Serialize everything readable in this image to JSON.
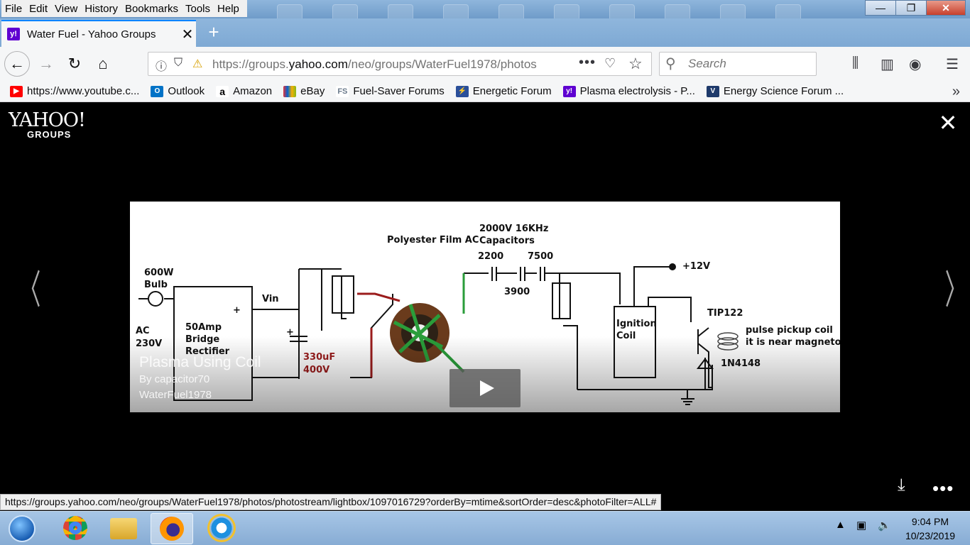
{
  "menu": {
    "items": [
      "File",
      "Edit",
      "View",
      "History",
      "Bookmarks",
      "Tools",
      "Help"
    ]
  },
  "window": {
    "minimize": "—",
    "maximize": "❐",
    "close": "✕"
  },
  "tab": {
    "title": "Water Fuel - Yahoo Groups",
    "favicon": "y!",
    "close": "✕",
    "new_tab": "+"
  },
  "nav": {
    "url_prefix": "https://groups.",
    "url_domain": "yahoo.com",
    "url_path": "/neo/groups/WaterFuel1978/photos",
    "search_placeholder": "Search"
  },
  "bookmarks": [
    {
      "label": "https://www.youtube.c...",
      "icon": "youtube-icon",
      "color": "#ff0000"
    },
    {
      "label": "Outlook",
      "icon": "outlook-icon",
      "color": "#0072c6"
    },
    {
      "label": "Amazon",
      "icon": "amazon-icon",
      "color": "#000000"
    },
    {
      "label": "eBay",
      "icon": "ebay-icon",
      "color": "#e53238"
    },
    {
      "label": "Fuel-Saver Forums",
      "icon": "fuelsaver-icon",
      "color": "#6b7b8c"
    },
    {
      "label": "Energetic Forum",
      "icon": "energetic-icon",
      "color": "#2a4f9a"
    },
    {
      "label": "Plasma electrolysis - P...",
      "icon": "yahoo-icon",
      "color": "#5f01d1"
    },
    {
      "label": "Energy Science Forum ...",
      "icon": "energyscience-icon",
      "color": "#1e3a6b"
    }
  ],
  "lightbox": {
    "logo_main": "YAHOO!",
    "logo_sub": "GROUPS",
    "close": "✕",
    "prev": "〈",
    "next": "〉",
    "photo": {
      "title": "Plasma Using Coil",
      "author": "By capacitor70",
      "group": "WaterFuel1978"
    }
  },
  "schematic": {
    "bulb": "600W\nBulb",
    "ac": "AC\n230V",
    "rectifier": "50Amp\nBridge\nRectifier",
    "plus": "+",
    "minus": "−",
    "vin": "Vin",
    "cap_plus": "+",
    "cap_value": "330uF",
    "cap_voltage": "400V",
    "film_caps": "Polyester Film AC",
    "rating": "2000V 16KHz",
    "capacitors": "Capacitors",
    "c1": "2200",
    "c2": "7500",
    "c3": "3900",
    "v12": "+12V",
    "ignition": "Ignition",
    "coil": "Coil",
    "tip": "TIP122",
    "pickup1": "pulse pickup coil",
    "pickup2": "it is near magneto",
    "diode": "1N4148"
  },
  "status_url": "https://groups.yahoo.com/neo/groups/WaterFuel1978/photos/photostream/lightbox/1097016729?orderBy=mtime&sortOrder=desc&photoFilter=ALL#",
  "clock": {
    "time": "9:04 PM",
    "date": "10/23/2019"
  }
}
